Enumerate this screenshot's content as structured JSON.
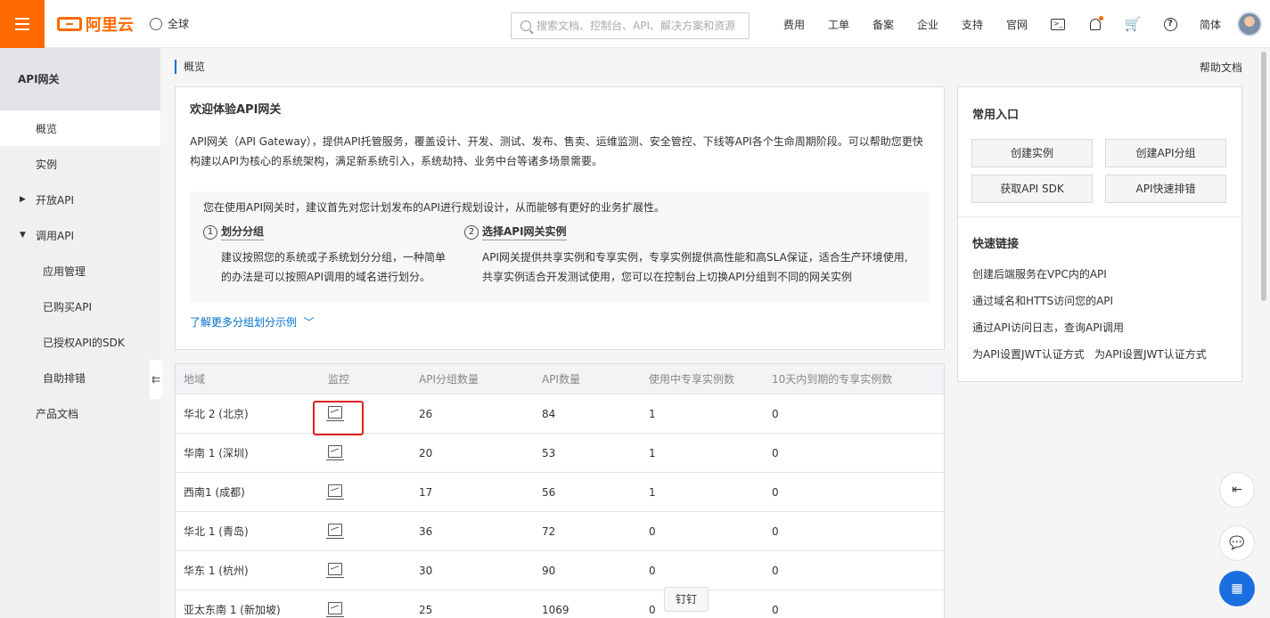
{
  "topbar": {
    "logo_text": "阿里云",
    "region_label": "全球",
    "search_placeholder": "搜索文档、控制台、API、解决方案和资源",
    "nav": [
      "费用",
      "工单",
      "备案",
      "企业",
      "支持",
      "官网"
    ],
    "lang": "简体",
    "accent_color": "#ff6a00"
  },
  "sidebar": {
    "title": "API网关",
    "items": [
      {
        "label": "概览"
      },
      {
        "label": "实例"
      },
      {
        "label": "开放API"
      },
      {
        "label": "调用API"
      },
      {
        "label": "应用管理"
      },
      {
        "label": "已购买API"
      },
      {
        "label": "已授权API的SDK"
      },
      {
        "label": "自助排错"
      },
      {
        "label": "产品文档"
      }
    ],
    "collapse_glyph": "⇇"
  },
  "breadcrumb": "概览",
  "help_doc": "帮助文档",
  "welcome": {
    "title": "欢迎体验API网关",
    "desc_line1": "API网关（API Gateway），提供API托管服务，覆盖设计、开发、测试、发布、售卖、运维监测、安全管控、下线等API各个生命周期阶段。可以帮助您更快",
    "desc_line2": "构建以API为核心的系统架构，满足新系统引入，系统劫持、业务中台等诸多场景需要。",
    "tip": "您在使用API网关时，建议首先对您计划发布的API进行规划设计，从而能够有更好的业务扩展性。",
    "step1_num": "1",
    "step1_title": "划分分组",
    "step1_line1": "建议按照您的系统或子系统划分分组，一种简单",
    "step1_line2": "的办法是可以按照API调用的域名进行划分。",
    "step2_num": "2",
    "step2_title": "选择API网关实例",
    "step2_line1": "API网关提供共享实例和专享实例，专享实例提供高性能和高SLA保证，适合生产环境使用,",
    "step2_line2": "共享实例适合开发测试使用，您可以在控制台上切换API分组到不同的网关实例",
    "learn_more": "了解更多分组划分示例"
  },
  "quick": {
    "title": "常用入口",
    "buttons": [
      "创建实例",
      "创建API分组",
      "获取API SDK",
      "API快速排错"
    ],
    "links_title": "快速链接",
    "links": [
      "创建后端服务在VPC内的API",
      "通过域名和HTTS访问您的API",
      "通过API访问日志，查询API调用",
      "为API设置JWT认证方式",
      "为API设置JWT认证方式"
    ]
  },
  "table": {
    "headers": [
      "地域",
      "监控",
      "API分组数量",
      "API数量",
      "使用中专享实例数",
      "10天内到期的专享实例数"
    ],
    "rows": [
      {
        "region": "华北 2 (北京)",
        "groups": "26",
        "apis": "84",
        "inuse": "1",
        "expiring": "0"
      },
      {
        "region": "华南 1 (深圳)",
        "groups": "20",
        "apis": "53",
        "inuse": "1",
        "expiring": "0"
      },
      {
        "region": "西南1 (成都)",
        "groups": "17",
        "apis": "56",
        "inuse": "1",
        "expiring": "0"
      },
      {
        "region": "华北 1 (青岛)",
        "groups": "36",
        "apis": "72",
        "inuse": "0",
        "expiring": "0"
      },
      {
        "region": "华东 1 (杭州)",
        "groups": "30",
        "apis": "90",
        "inuse": "0",
        "expiring": "0"
      },
      {
        "region": "亚太东南 1 (新加坡)",
        "groups": "25",
        "apis": "1069",
        "inuse": "0",
        "expiring": "0"
      }
    ],
    "highlight_color": "#e02020"
  },
  "tooltip": "钉钉"
}
